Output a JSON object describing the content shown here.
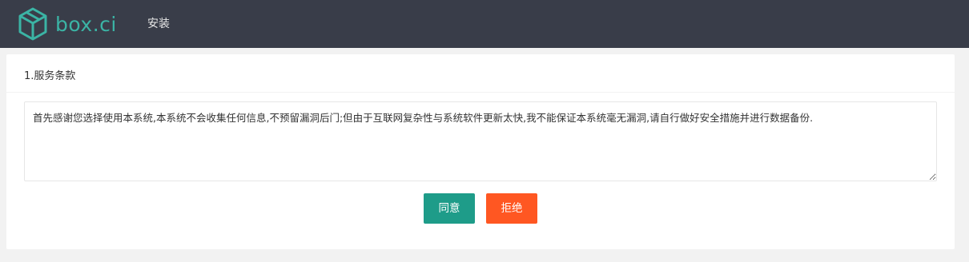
{
  "header": {
    "logo_text": "box.ci",
    "nav_items": [
      {
        "label": "安装"
      }
    ]
  },
  "card": {
    "title": "1.服务条款",
    "terms_text": "首先感谢您选择使用本系统,本系统不会收集任何信息,不预留漏洞后门;但由于互联网复杂性与系统软件更新太快,我不能保证本系统毫无漏洞,请自行做好安全措施并进行数据备份."
  },
  "buttons": {
    "agree_label": "同意",
    "refuse_label": "拒绝"
  },
  "colors": {
    "topbar": "#393d49",
    "logo": "#3bb4a5",
    "agree": "#1e9c89",
    "refuse": "#ff5722"
  },
  "icons": {
    "logo": "box-cube-icon"
  }
}
